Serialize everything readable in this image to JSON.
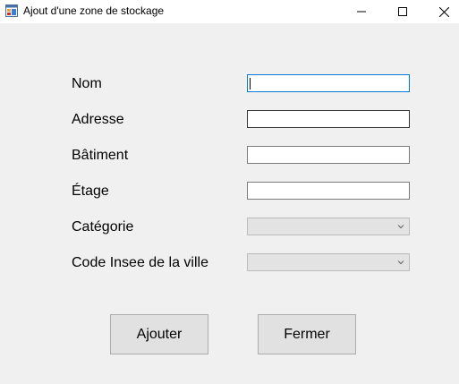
{
  "window": {
    "title": "Ajout d'une zone de stockage"
  },
  "form": {
    "fields": [
      {
        "label": "Nom",
        "value": ""
      },
      {
        "label": "Adresse",
        "value": ""
      },
      {
        "label": "Bâtiment",
        "value": ""
      },
      {
        "label": "Étage",
        "value": ""
      },
      {
        "label": "Catégorie",
        "value": ""
      },
      {
        "label": "Code Insee de la ville",
        "value": ""
      }
    ]
  },
  "buttons": {
    "add_label": "Ajouter",
    "close_label": "Fermer"
  },
  "icons": {
    "app": "app-form-icon",
    "minimize": "minimize-icon",
    "maximize": "maximize-icon",
    "close": "close-icon",
    "dropdown": "chevron-down-icon"
  },
  "colors": {
    "background": "#f0f0f0",
    "focus_border": "#0078d7",
    "button_face": "#e1e1e1",
    "disabled_combo": "#e3e3e3"
  }
}
